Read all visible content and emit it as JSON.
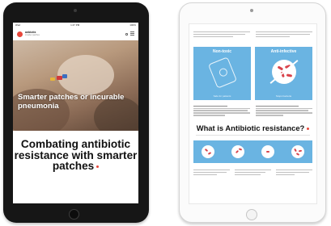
{
  "left_tablet": {
    "status_bar": {
      "carrier": "iPad",
      "time": "1:47 PM",
      "battery": "100%"
    },
    "logo": {
      "name": "anbiotix",
      "tagline": "smarter patches"
    },
    "hero_headline": "Smarter patches or incurable pneumonia",
    "main_headline": "Combating antibiotic resistance with smarter patches",
    "colors": {
      "accent": "#e8473b",
      "text": "#111111"
    }
  },
  "right_tablet": {
    "cards": [
      {
        "title": "Non-toxic",
        "caption": "Safe for patients",
        "icon": "patch-icon"
      },
      {
        "title": "Anti-infective",
        "caption": "Stops bacteria",
        "icon": "no-bacteria-icon"
      }
    ],
    "section_heading": "What is Antibiotic resistance?",
    "colors": {
      "card_blue": "#6ab4e2",
      "bacteria_red": "#d9434b"
    },
    "strip_icons": [
      "bacteria-1-icon",
      "bacteria-2-icon",
      "bacteria-3-icon",
      "bacteria-4-icon"
    ]
  }
}
